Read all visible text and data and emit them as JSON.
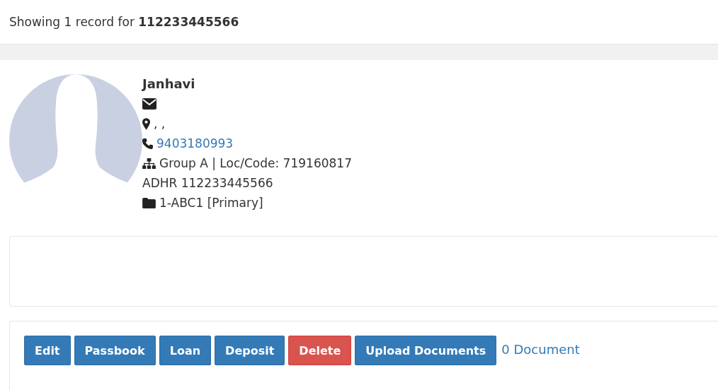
{
  "header": {
    "text": "Showing 1 record for **112233445566**"
  },
  "profile": {
    "name": "Janhavi",
    "lines": [
      {
        "kind": "email"
      },
      {
        "kind": "location",
        "text": ", ,"
      },
      {
        "kind": "phone",
        "text": "9403180993"
      },
      {
        "kind": "group",
        "text": "Group A | Loc/Code: 719160817"
      },
      {
        "kind": "plain",
        "text": "ADHR 112233445566"
      },
      {
        "kind": "folder",
        "text": "1-ABC1 [Primary]"
      }
    ]
  },
  "actions": {
    "buttons": [
      {
        "label": "Edit",
        "kind": "primary"
      },
      {
        "label": "Passbook",
        "kind": "primary"
      },
      {
        "label": "Loan",
        "kind": "primary"
      },
      {
        "label": "Deposit",
        "kind": "primary"
      },
      {
        "label": "Delete",
        "kind": "danger"
      },
      {
        "label": "Upload Documents",
        "kind": "primary"
      }
    ],
    "documents_link": "0 Document"
  }
}
